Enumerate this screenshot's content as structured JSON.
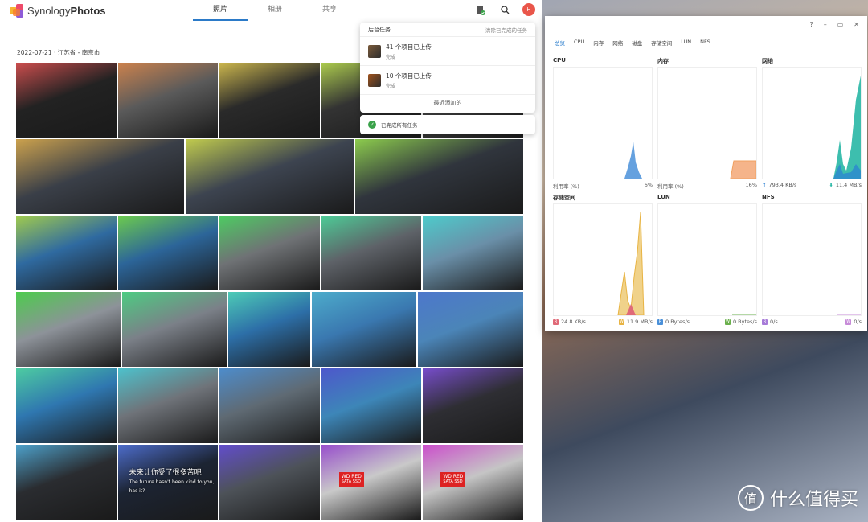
{
  "app": {
    "name_light": "Synology",
    "name_bold": "Photos"
  },
  "nav": {
    "tabs": [
      "照片",
      "相册",
      "共享"
    ],
    "active": 0
  },
  "user": {
    "avatar_initial": "H",
    "avatar_color": "#e9564a"
  },
  "date_group": {
    "date": "2022-07-21",
    "separator": "·",
    "location": "江苏省 - 南京市"
  },
  "photos": {
    "rows": [
      [
        {
          "w": 125,
          "g": "#222"
        },
        {
          "w": 125,
          "g": "#5a5a5a"
        },
        {
          "w": 125,
          "g": "#2a2a2a"
        },
        {
          "w": 125,
          "g": "#333"
        },
        {
          "w": 125,
          "g": "#444"
        }
      ],
      [
        {
          "w": 209,
          "g": "#3a3f48"
        },
        {
          "w": 209,
          "g": "#3d4450"
        },
        {
          "w": 209,
          "g": "#30353d"
        }
      ],
      [
        {
          "w": 125,
          "g": "#2f6aa0"
        },
        {
          "w": 125,
          "g": "#2c6599"
        },
        {
          "w": 125,
          "g": "#6f7275"
        },
        {
          "w": 125,
          "g": "#5e6268"
        },
        {
          "w": 125,
          "g": "#6a8fa8"
        }
      ],
      [
        {
          "w": 130,
          "g": "#8d9299"
        },
        {
          "w": 130,
          "g": "#7b8088"
        },
        {
          "w": 102,
          "g": "#2d6fa8"
        },
        {
          "w": 130,
          "g": "#3a78b0"
        },
        {
          "w": 131,
          "g": "#4b85b8"
        }
      ],
      [
        {
          "w": 125,
          "g": "#2f77b0"
        },
        {
          "w": 125,
          "g": "#6f7379"
        },
        {
          "w": 125,
          "g": "#5f6a73"
        },
        {
          "w": 125,
          "g": "#3d86b8"
        },
        {
          "w": 125,
          "g": "#2e2e33"
        }
      ],
      [
        {
          "w": 125,
          "g": "#2a2c30"
        },
        {
          "w": 125,
          "g": "#1c2433",
          "caption": "未来让你受了很多苦吧",
          "sub": "The future hasn't been kind to you, has it?"
        },
        {
          "w": 125,
          "g": "#4d5258"
        },
        {
          "w": 125,
          "g": "#c9c9c9",
          "ssd": "WD RED",
          "ssd_sub": "SATA SSD"
        },
        {
          "w": 125,
          "g": "#c5c5c5",
          "ssd": "WD RED",
          "ssd_sub": "SATA SSD"
        }
      ]
    ]
  },
  "tasks": {
    "title": "后台任务",
    "clear_label": "清除已完成的任务",
    "items": [
      {
        "title": "41 个项目已上传",
        "status": "完成"
      },
      {
        "title": "10 个项目已上传",
        "status": "完成"
      }
    ],
    "footer": "最近添加的",
    "toast": "已完成所有任务"
  },
  "monitor": {
    "window_controls": [
      "?",
      "–",
      "▭",
      "✕"
    ],
    "tabs": [
      "总览",
      "CPU",
      "内存",
      "网络",
      "磁盘",
      "存储空间",
      "LUN",
      "NFS"
    ],
    "active_tab": 0,
    "panels": [
      {
        "title": "CPU",
        "left_label": "利用率 (%)",
        "right_label": "6%",
        "colors": [
          "#4a90d9"
        ]
      },
      {
        "title": "内存",
        "left_label": "利用率 (%)",
        "right_label": "16%",
        "colors": [
          "#f0a060"
        ]
      },
      {
        "title": "网络",
        "up_label": "793.4 KB/s",
        "down_label": "11.4 MB/s",
        "colors": [
          "#2a7fd4",
          "#1bb3a0"
        ]
      },
      {
        "title": "存储空间",
        "r_label": "24.8 KB/s",
        "w_label": "11.9 MB/s",
        "r_tag": "R",
        "w_tag": "W",
        "colors": [
          "#e06a78",
          "#e8b444"
        ]
      },
      {
        "title": "LUN",
        "r_label": "0 Bytes/s",
        "w_label": "0 Bytes/s",
        "r_tag": "R",
        "w_tag": "W",
        "colors": [
          "#4a90d9",
          "#6ab04c"
        ]
      },
      {
        "title": "NFS",
        "r_label": "0/s",
        "w_label": "0/s",
        "r_tag": "R",
        "w_tag": "W",
        "colors": [
          "#a77bd8",
          "#c78bd8"
        ]
      }
    ]
  },
  "watermark": {
    "symbol": "值",
    "text": "什么值得买"
  }
}
